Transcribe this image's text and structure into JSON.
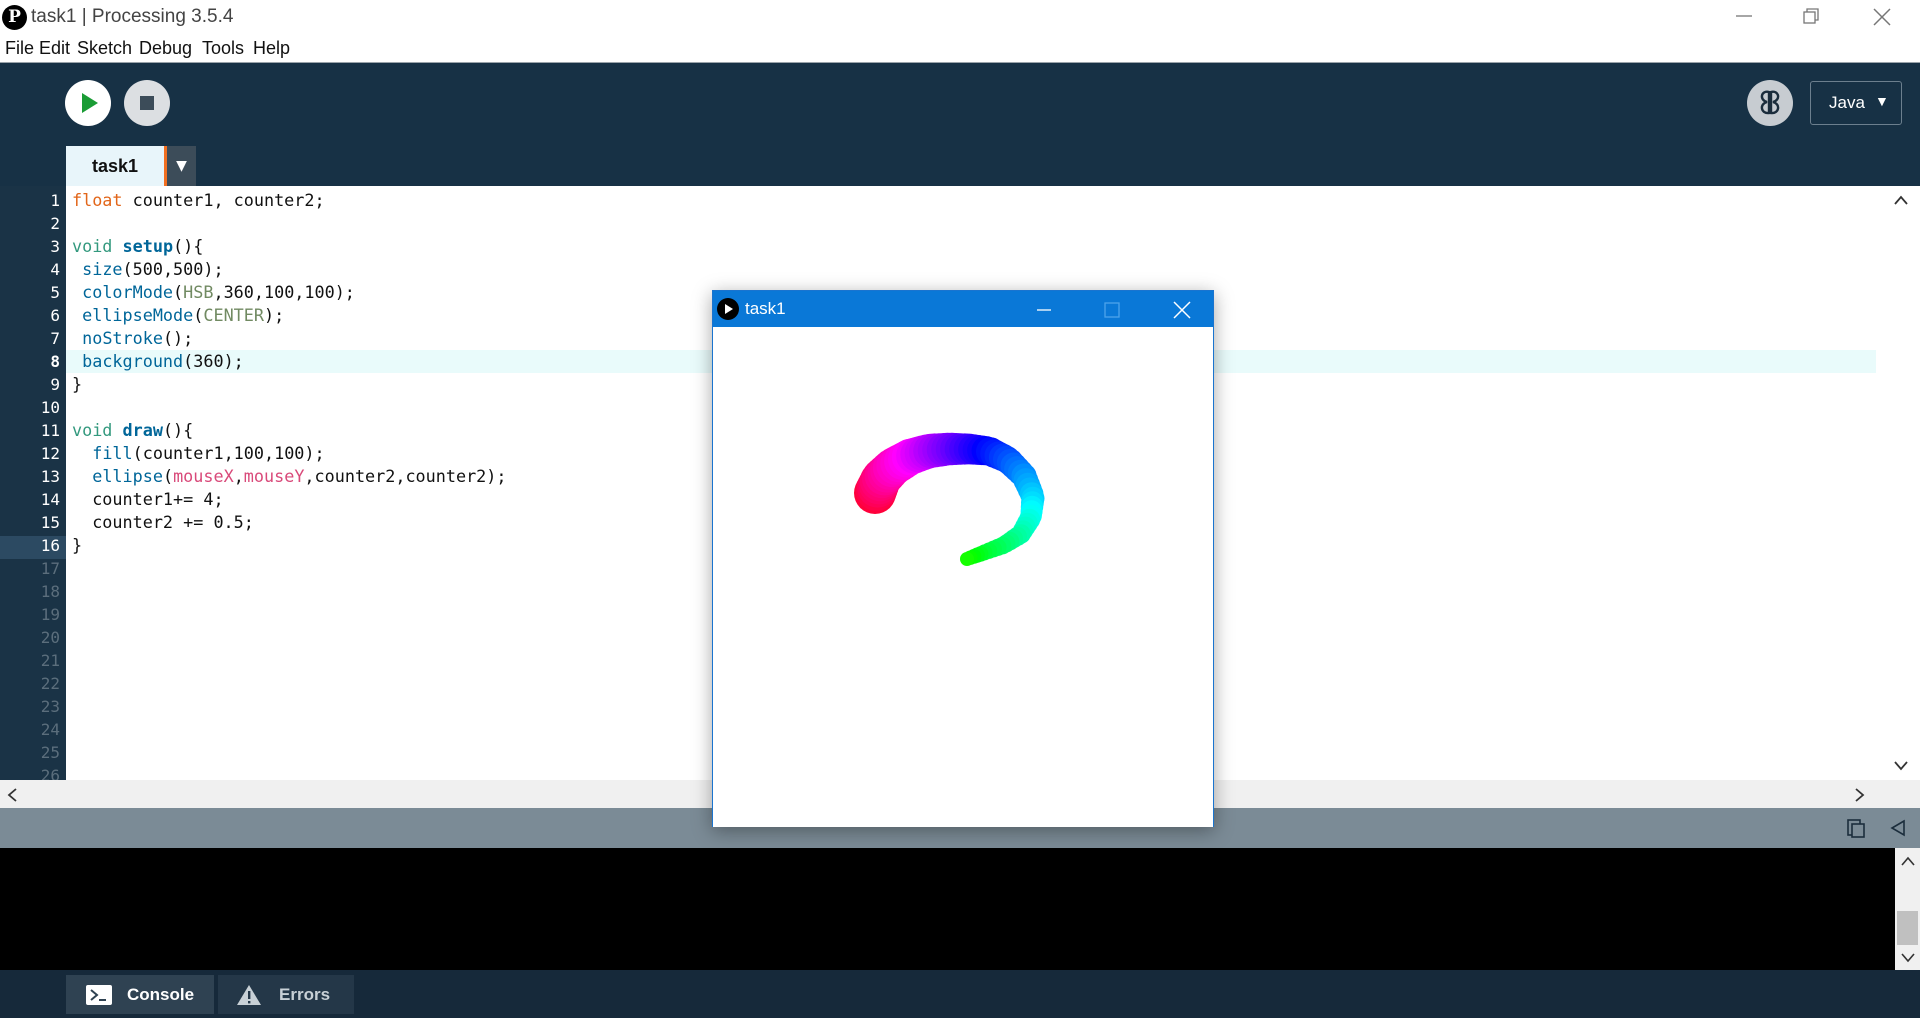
{
  "window": {
    "title": "task1 | Processing 3.5.4"
  },
  "menu": [
    "File",
    "Edit",
    "Sketch",
    "Debug",
    "Tools",
    "Help"
  ],
  "toolbar": {
    "mode": "Java"
  },
  "tab": {
    "name": "task1"
  },
  "editor": {
    "current_line": 8,
    "line_numbers": [
      "1",
      "2",
      "3",
      "4",
      "5",
      "6",
      "7",
      "8",
      "9",
      "10",
      "11",
      "12",
      "13",
      "14",
      "15",
      "16",
      "17",
      "18",
      "19",
      "20",
      "21",
      "22",
      "23",
      "24",
      "25",
      "26"
    ],
    "code_lines": [
      "float counter1, counter2;",
      "",
      "void setup(){",
      " size(500,500);",
      " colorMode(HSB,360,100,100);",
      " ellipseMode(CENTER);",
      " noStroke();",
      " background(360);",
      "}",
      "",
      "void draw(){",
      "  fill(counter1,100,100);",
      "  ellipse(mouseX,mouseY,counter2,counter2);",
      "  counter1+= 4;",
      "  counter2 += 0.5;",
      "}"
    ]
  },
  "bottom_tabs": {
    "console": "Console",
    "errors": "Errors"
  },
  "sketch_window": {
    "title": "task1",
    "stroke": {
      "hue_start_color": "#ff0040",
      "hue_end_color": "#11ee22"
    }
  },
  "colors": {
    "toolbar_bg": "#173145",
    "tab_accent": "#f26f20",
    "current_line_bg": "#e9fbfb",
    "sketch_titlebar": "#0a78d7"
  }
}
